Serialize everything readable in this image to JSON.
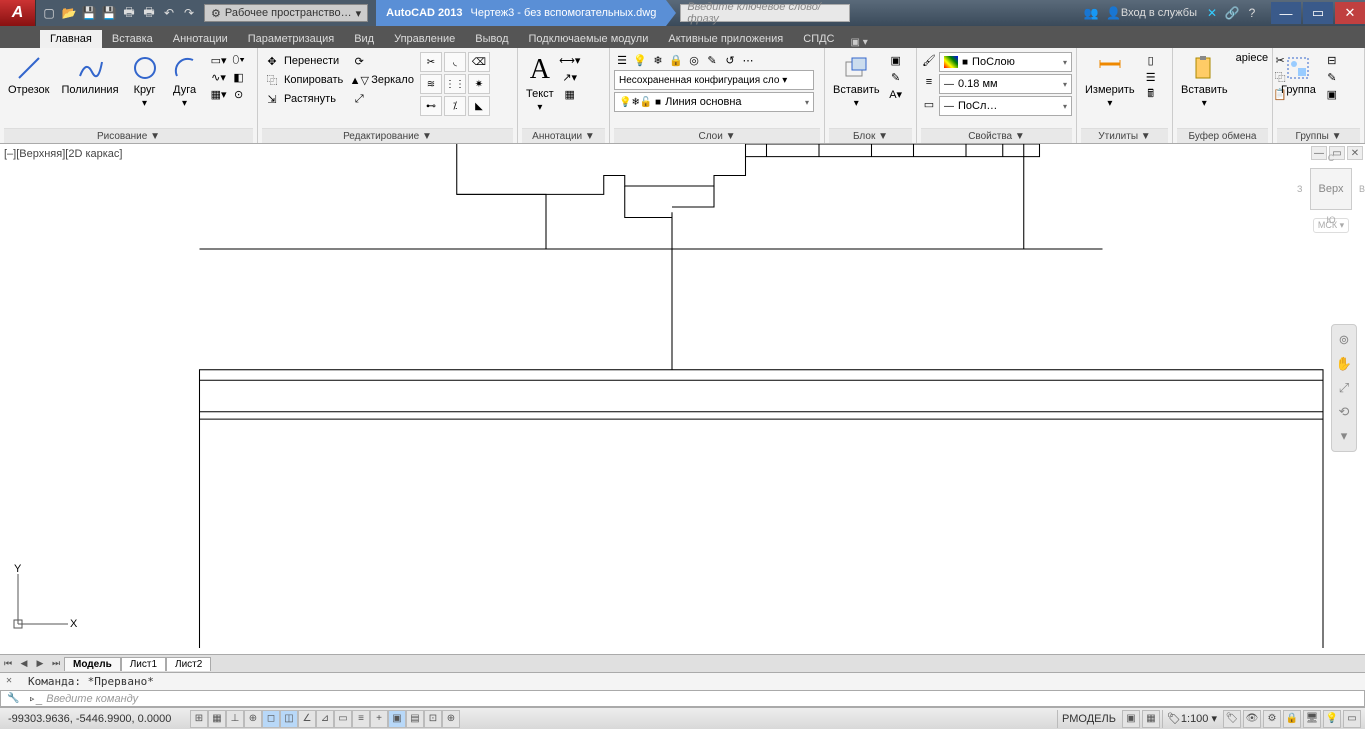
{
  "title": {
    "app": "AutoCAD 2013",
    "file": "Чертеж3 - без вспомогательных.dwg"
  },
  "workspace": "Рабочее пространство…",
  "search_placeholder": "Введите ключевое слово/фразу",
  "login": "Вход в службы",
  "tabs": [
    "Главная",
    "Вставка",
    "Аннотации",
    "Параметризация",
    "Вид",
    "Управление",
    "Вывод",
    "Подключаемые модули",
    "Активные приложения",
    "СПДС"
  ],
  "panels": {
    "draw": {
      "title": "Рисование ▼",
      "line": "Отрезок",
      "pline": "Полилиния",
      "circle": "Круг",
      "arc": "Дуга"
    },
    "edit": {
      "title": "Редактирование ▼",
      "move": "Перенести",
      "copy": "Копировать",
      "stretch": "Растянуть",
      "mirror": "Зеркало"
    },
    "annot": {
      "title": "Аннотации ▼",
      "text": "Текст"
    },
    "layers": {
      "title": "Слои ▼",
      "unsaved": "Несохраненная конфигурация сло ▾",
      "linetype": "Линия основна"
    },
    "block": {
      "title": "Блок ▼",
      "insert": "Вставить"
    },
    "props": {
      "title": "Свойства ▼",
      "bylayer": "ПоСлою",
      "lw": "0.18 мм",
      "lt": "ПоСл…"
    },
    "util": {
      "title": "Утилиты ▼",
      "measure": "Измерить"
    },
    "clip": {
      "title": "Буфер обмена",
      "paste": "Вставить"
    },
    "group": {
      "title": "Группы ▼",
      "group": "Группа"
    }
  },
  "viewport": "[–][Верхняя][2D каркас]",
  "viewcube": {
    "top": "Верх",
    "n": "С",
    "e": "В",
    "s": "Ю",
    "w": "З",
    "wcs": "МСК ▾"
  },
  "layout_tabs": [
    "Модель",
    "Лист1",
    "Лист2"
  ],
  "cmd": {
    "history": "Команда: *Прервано*",
    "placeholder": "Введите команду"
  },
  "status": {
    "coords": "-99303.9636, -5446.9900, 0.0000",
    "space": "РМОДЕЛЬ",
    "scale": "1:100 ▾"
  }
}
